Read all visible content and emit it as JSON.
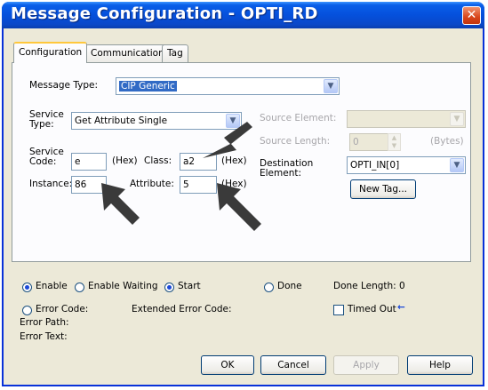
{
  "window": {
    "title": "Message Configuration - OPTI_RD",
    "close_glyph": "✕"
  },
  "tabs": [
    {
      "label": "Configuration",
      "active": true
    },
    {
      "label": "Communication",
      "active": false
    },
    {
      "label": "Tag",
      "active": false
    }
  ],
  "config": {
    "message_type_label": "Message Type:",
    "message_type_value": "CIP Generic",
    "service_type_label": "Service\nType:",
    "service_type_value": "Get Attribute Single",
    "service_code_label": "Service\nCode:",
    "service_code_value": "e",
    "service_code_unit": "(Hex)",
    "class_label": "Class:",
    "class_value": "a2",
    "class_unit": "(Hex)",
    "instance_label": "Instance:",
    "instance_value": "86",
    "attribute_label": "Attribute:",
    "attribute_value": "5",
    "attribute_unit": "(Hex)",
    "source_element_label": "Source Element:",
    "source_element_value": "",
    "source_length_label": "Source Length:",
    "source_length_value": "0",
    "source_length_unit": "(Bytes)",
    "destination_label": "Destination\nElement:",
    "destination_value": "OPTI_IN[0]",
    "new_tag_label": "New Tag..."
  },
  "status": {
    "enable_label": "Enable",
    "enable_waiting_label": "Enable Waiting",
    "start_label": "Start",
    "done_label": "Done",
    "done_length_label": "Done Length: 0",
    "error_code_label": "Error Code:",
    "extended_error_label": "Extended Error Code:",
    "timed_out_label": "Timed Out",
    "timed_out_arrow": "←",
    "error_path_label": "Error Path:",
    "error_text_label": "Error Text:"
  },
  "buttons": {
    "ok": "OK",
    "cancel": "Cancel",
    "apply": "Apply",
    "help": "Help"
  },
  "colors": {
    "titlebar": "#0550dc",
    "close": "#d8451b",
    "dialog_bg": "#ece9d8",
    "annotation_arrow": "#3a3a3a"
  }
}
